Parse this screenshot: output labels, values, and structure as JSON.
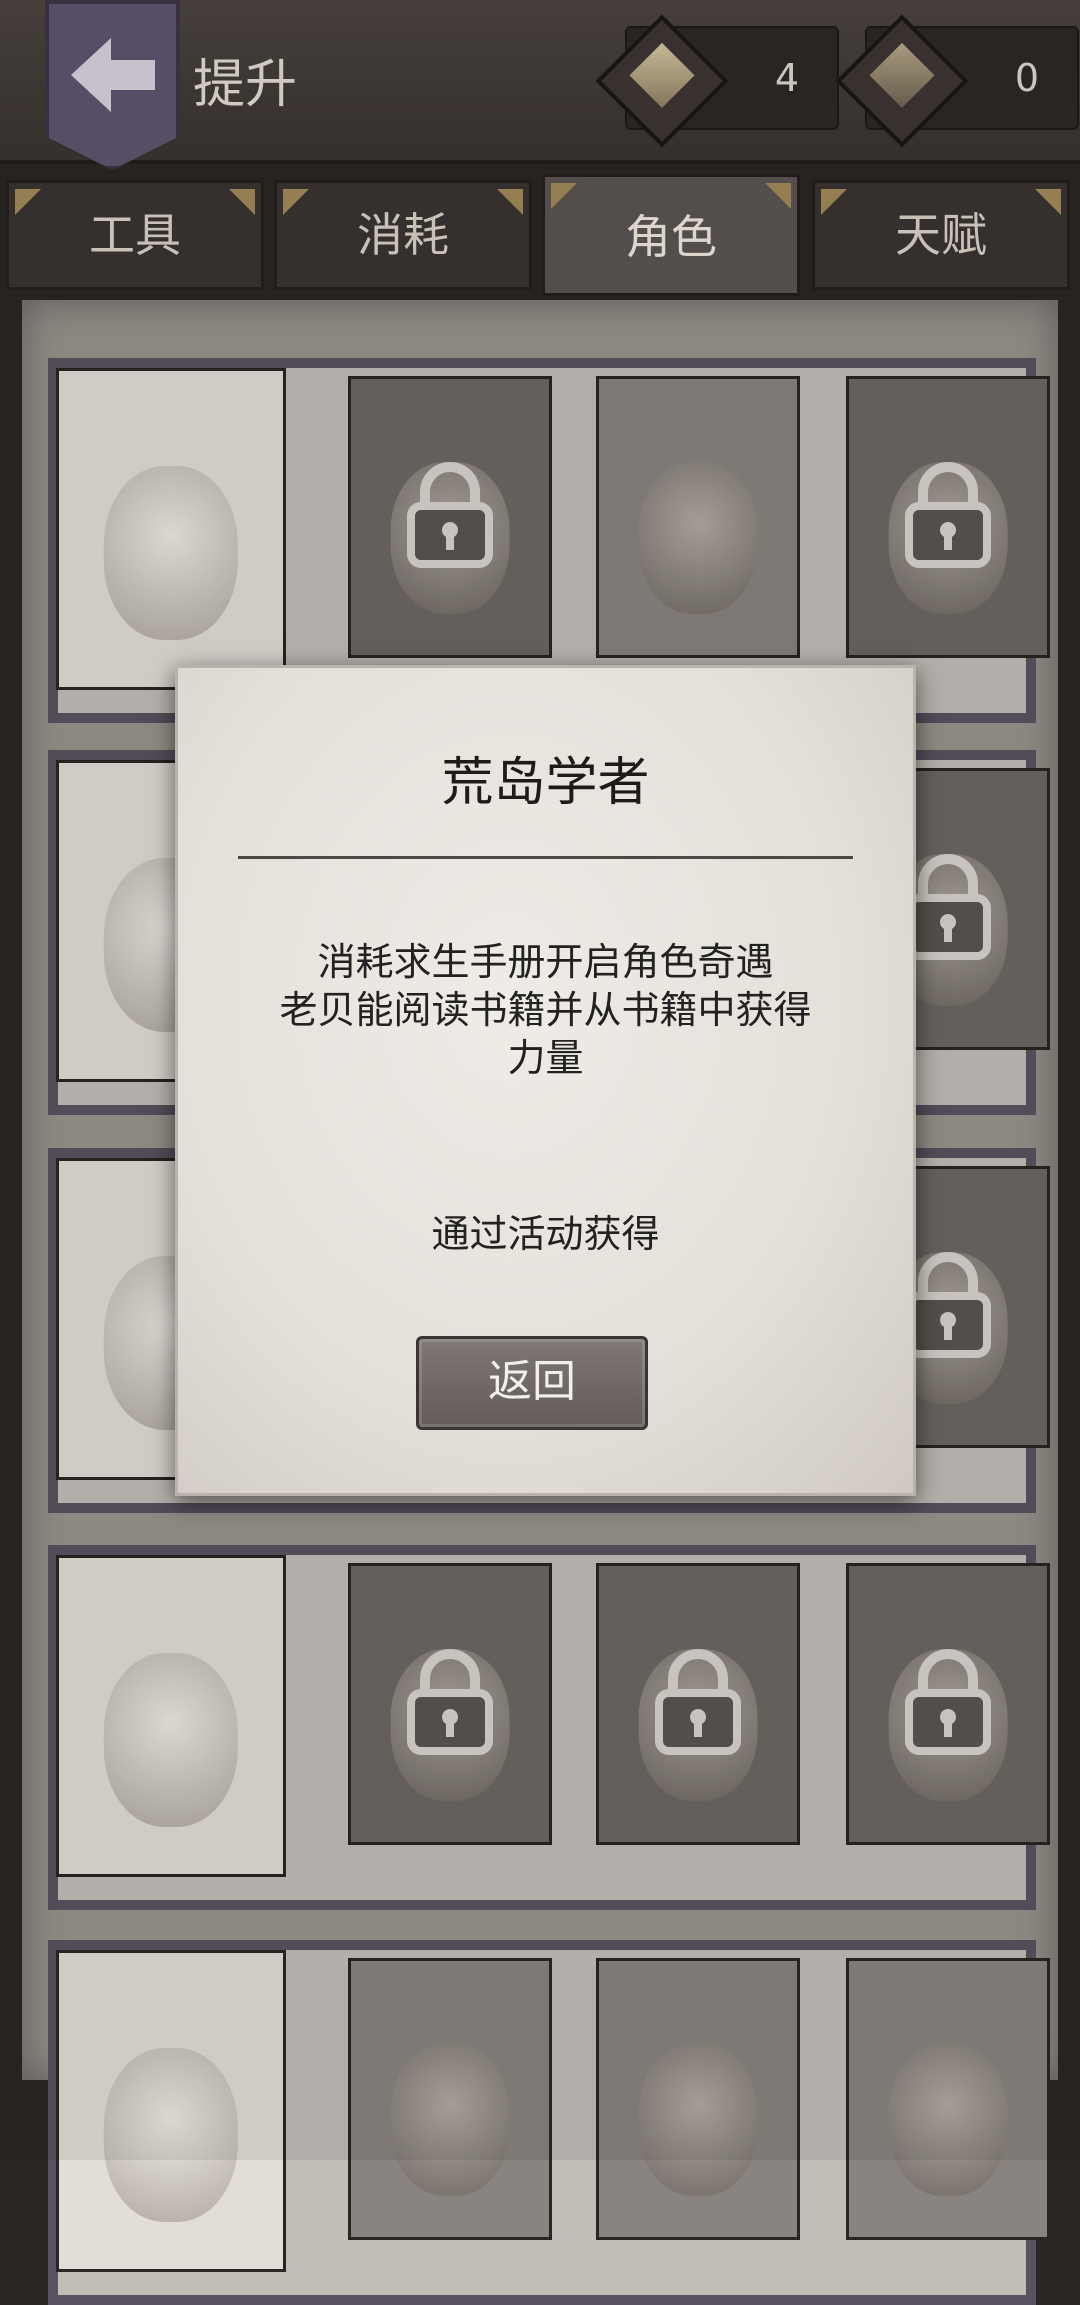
{
  "header": {
    "title": "提升",
    "currencies": [
      {
        "icon": "crafting-material-icon",
        "amount": "4"
      },
      {
        "icon": "manual-book-icon",
        "amount": "0"
      }
    ]
  },
  "tabs": [
    {
      "label": "工具",
      "active": false
    },
    {
      "label": "消耗",
      "active": false
    },
    {
      "label": "角色",
      "active": true
    },
    {
      "label": "天赋",
      "active": false
    }
  ],
  "character_rows": [
    {
      "portraits": [
        {
          "name": "chef",
          "locked": false
        },
        {
          "name": "bandana-survivor",
          "locked": true
        },
        {
          "name": "straw-hat-survivor",
          "locked": false
        },
        {
          "name": "fur-hat-survivor",
          "locked": true
        }
      ]
    },
    {
      "portraits": [
        {
          "name": "hooded-woman",
          "locked": false
        },
        {
          "name": "hidden-a",
          "locked": false
        },
        {
          "name": "hidden-b",
          "locked": false
        },
        {
          "name": "dark-hood-survivor",
          "locked": true
        }
      ]
    },
    {
      "portraits": [
        {
          "name": "castaway",
          "locked": false
        },
        {
          "name": "hidden-c",
          "locked": false
        },
        {
          "name": "hidden-d",
          "locked": false
        },
        {
          "name": "curly-hair-survivor",
          "locked": true
        }
      ]
    },
    {
      "portraits": [
        {
          "name": "sunglasses-explorer",
          "locked": false
        },
        {
          "name": "beanie-survivor",
          "locked": true
        },
        {
          "name": "reindeer-santa",
          "locked": true
        },
        {
          "name": "goggles-santa",
          "locked": true
        }
      ]
    },
    {
      "portraits": [
        {
          "name": "pirate",
          "locked": false
        },
        {
          "name": "hidden-e",
          "locked": false
        },
        {
          "name": "hidden-f",
          "locked": false
        },
        {
          "name": "hidden-g",
          "locked": false
        }
      ]
    }
  ],
  "dialog": {
    "title": "荒岛学者",
    "description_lines": [
      "消耗求生手册开启角色奇遇",
      "老贝能阅读书籍并从书籍中获得",
      "力量"
    ],
    "source": "通过活动获得",
    "return_label": "返回"
  }
}
